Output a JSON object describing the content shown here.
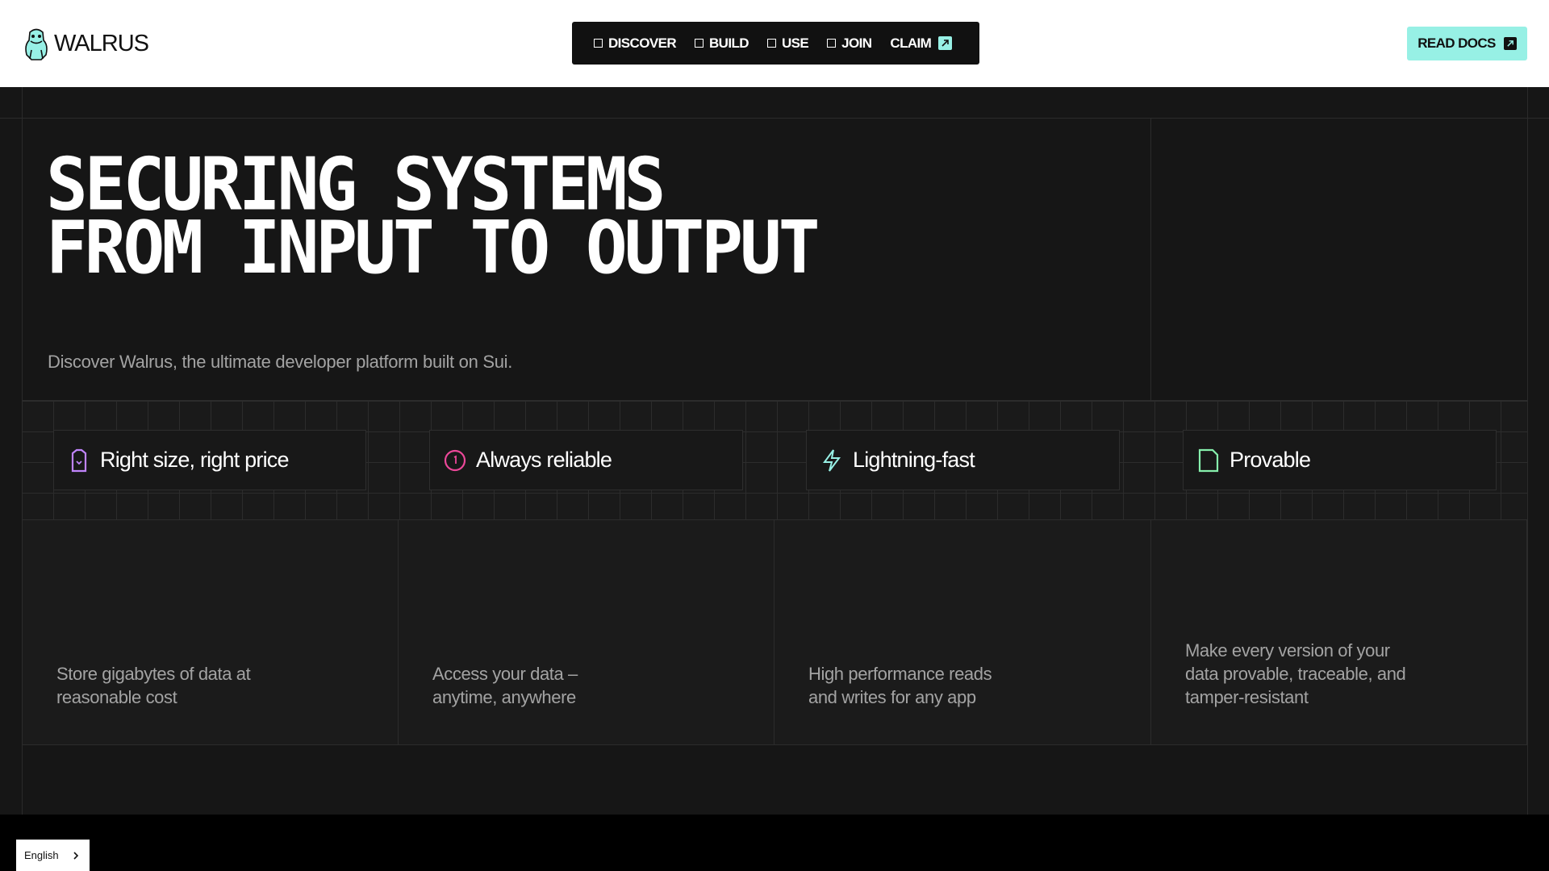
{
  "header": {
    "logo_text": "WALRUS",
    "nav": [
      {
        "label": "DISCOVER",
        "external": false
      },
      {
        "label": "BUILD",
        "external": false
      },
      {
        "label": "USE",
        "external": false
      },
      {
        "label": "JOIN",
        "external": false
      },
      {
        "label": "CLAIM",
        "external": true
      }
    ],
    "docs_label": "READ DOCS"
  },
  "hero": {
    "title_line1": "SECURING SYSTEMS",
    "title_line2": "FROM INPUT TO OUTPUT",
    "subtitle": "Discover Walrus, the ultimate developer platform built on Sui."
  },
  "features": [
    {
      "title": "Right size, right price",
      "icon": "price-tag-icon",
      "icon_color": "#c084fc",
      "description": "Store gigabytes of data at\nreasonable cost"
    },
    {
      "title": "Always reliable",
      "icon": "reliable-clock-icon",
      "icon_color": "#ec4899",
      "description": "Access your data –\nanytime, anywhere"
    },
    {
      "title": "Lightning-fast",
      "icon": "lightning-icon",
      "icon_color": "#97f0e5",
      "description": "High performance reads\nand writes for any app"
    },
    {
      "title": "Provable",
      "icon": "document-icon",
      "icon_color": "#86efac",
      "description": "Make every version of your\ndata provable, traceable, and\ntamper-resistant"
    }
  ],
  "language": {
    "label": "English"
  },
  "colors": {
    "accent": "#97f0e5",
    "background": "#161616",
    "muted_text": "#a3a3a3"
  }
}
